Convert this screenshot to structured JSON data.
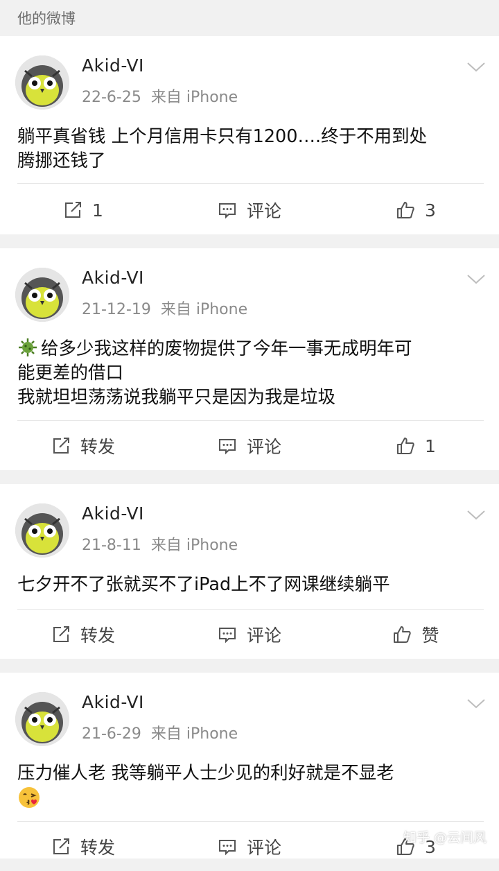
{
  "section_title": "他的微博",
  "posts": [
    {
      "username": "Akid-VI",
      "date": "22-6-25",
      "source": "来自 iPhone",
      "lines": [
        "躺平真省钱 上个月信用卡只有1200….终于不用到处",
        "腾挪还钱了"
      ],
      "repost": "1",
      "comment": "评论",
      "like": "3"
    },
    {
      "username": "Akid-VI",
      "date": "21-12-19",
      "source": "来自 iPhone",
      "lines": [
        "给多少我这样的废物提供了今年一事无成明年可",
        "能更差的借口",
        "我就坦坦荡荡说我躺平只是因为我是垃圾"
      ],
      "repost": "转发",
      "comment": "评论",
      "like": "1"
    },
    {
      "username": "Akid-VI",
      "date": "21-8-11",
      "source": "来自 iPhone",
      "lines": [
        "七夕开不了张就买不了iPad上不了网课继续躺平"
      ],
      "repost": "转发",
      "comment": "评论",
      "like": "赞"
    },
    {
      "username": "Akid-VI",
      "date": "21-6-29",
      "source": "来自 iPhone",
      "lines": [
        "压力催人老 我等躺平人士少见的利好就是不显老"
      ],
      "repost": "转发",
      "comment": "评论",
      "like": "3"
    }
  ],
  "watermark": "知乎 @云间风"
}
